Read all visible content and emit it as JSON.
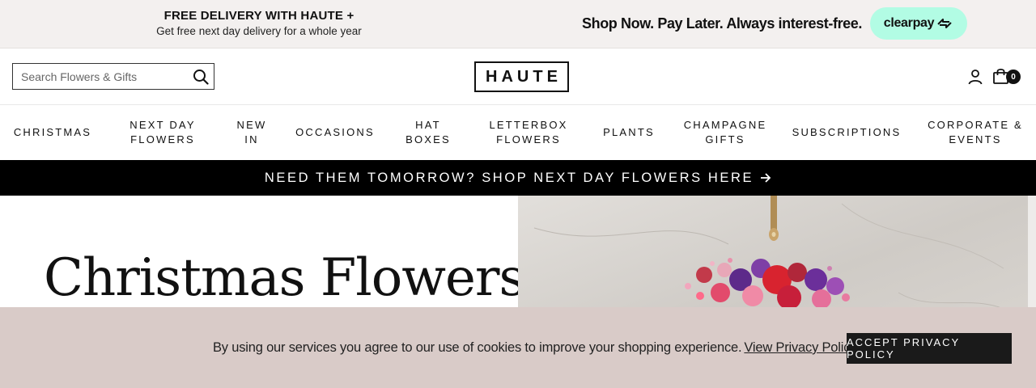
{
  "promo": {
    "title": "FREE DELIVERY WITH HAUTE +",
    "subtitle": "Get free next day delivery for a whole year",
    "pay_later": "Shop Now. Pay Later. Always interest-free.",
    "clearpay_label": "clearpay",
    "clearpay_color": "#b2fce4"
  },
  "header": {
    "search_placeholder": "Search Flowers & Gifts",
    "search_value": "",
    "search_icon": "search-icon",
    "logo": "HAUTE",
    "account_icon": "user-icon",
    "cart_icon": "bag-icon",
    "cart_count": "0"
  },
  "nav": {
    "items": [
      "CHRISTMAS",
      "NEXT DAY\nFLOWERS",
      "NEW\nIN",
      "OCCASIONS",
      "HAT\nBOXES",
      "LETTERBOX\nFLOWERS",
      "PLANTS",
      "CHAMPAGNE\nGIFTS",
      "SUBSCRIPTIONS",
      "CORPORATE &\nEVENTS"
    ]
  },
  "banner": {
    "text": "NEED THEM TOMORROW? SHOP NEXT DAY FLOWERS HERE",
    "icon": "arrow-right-icon",
    "color": "#000000"
  },
  "hero": {
    "title": "Christmas Flowers"
  },
  "cookie": {
    "text": "By using our services you agree to our use of cookies to improve your shopping experience.",
    "link": "View Privacy Policy",
    "accept": "ACCEPT PRIVACY POLICY",
    "background": "#d9cbc8"
  }
}
